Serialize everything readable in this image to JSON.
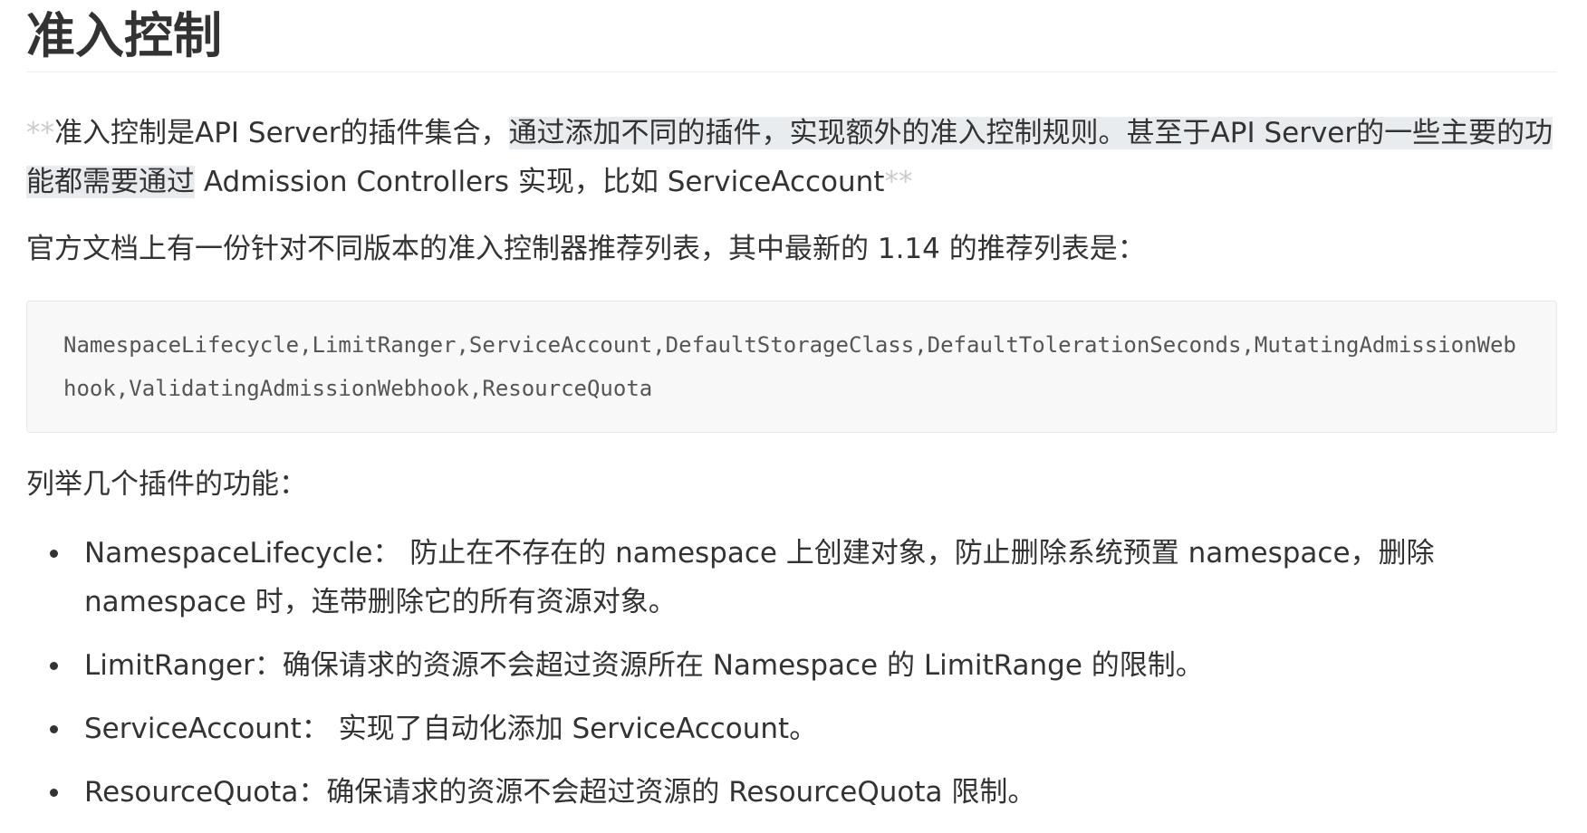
{
  "title": "准入控制",
  "intro": {
    "stars_open": "**",
    "text_start": "准入控制是API Server的插件集合，",
    "text_highlight": "通过添加不同的插件，实现额外的准入控制规则。甚至于API Server的一些主要的功能都需要通过",
    "text_end": " Admission Controllers 实现，比如 ServiceAccount",
    "stars_close": "**"
  },
  "recommend_text": "官方文档上有一份针对不同版本的准入控制器推荐列表，其中最新的 1.14 的推荐列表是：",
  "code": "NamespaceLifecycle,LimitRanger,ServiceAccount,DefaultStorageClass,DefaultTolerationSeconds,MutatingAdmissionWebhook,ValidatingAdmissionWebhook,ResourceQuota",
  "list_heading": "列举几个插件的功能：",
  "features": [
    {
      "name": "NamespaceLifecycle",
      "desc": "：  防止在不存在的 namespace 上创建对象，防止删除系统预置 namespace，删除 namespace 时，连带删除它的所有资源对象。"
    },
    {
      "name": "LimitRanger",
      "desc": "：确保请求的资源不会超过资源所在 Namespace 的 LimitRange 的限制。"
    },
    {
      "name": "ServiceAccount",
      "desc": "：  实现了自动化添加 ServiceAccount。"
    },
    {
      "name": "ResourceQuota",
      "desc": "：确保请求的资源不会超过资源的 ResourceQuota 限制。"
    }
  ]
}
